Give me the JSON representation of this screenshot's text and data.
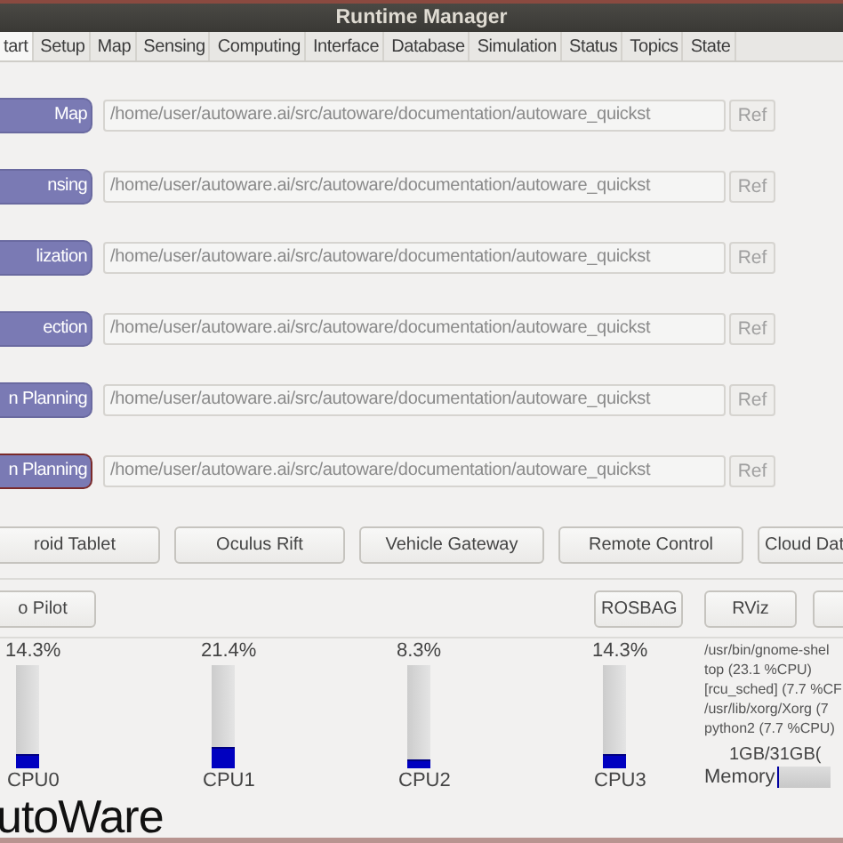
{
  "window": {
    "title": "Runtime Manager"
  },
  "tabs": [
    {
      "label": "tart",
      "selected": true
    },
    {
      "label": "Setup",
      "selected": false
    },
    {
      "label": "Map",
      "selected": false
    },
    {
      "label": "Sensing",
      "selected": false
    },
    {
      "label": "Computing",
      "selected": false
    },
    {
      "label": "Interface",
      "selected": false
    },
    {
      "label": "Database",
      "selected": false
    },
    {
      "label": "Simulation",
      "selected": false
    },
    {
      "label": "Status",
      "selected": false
    },
    {
      "label": "Topics",
      "selected": false
    },
    {
      "label": "State",
      "selected": false
    }
  ],
  "launch_rows": [
    {
      "button": "Map",
      "path": "/home/user/autoware.ai/src/autoware/documentation/autoware_quickst",
      "ref": "Ref",
      "focused": false
    },
    {
      "button": "nsing",
      "path": "/home/user/autoware.ai/src/autoware/documentation/autoware_quickst",
      "ref": "Ref",
      "focused": false
    },
    {
      "button": "lization",
      "path": "/home/user/autoware.ai/src/autoware/documentation/autoware_quickst",
      "ref": "Ref",
      "focused": false
    },
    {
      "button": "ection",
      "path": "/home/user/autoware.ai/src/autoware/documentation/autoware_quickst",
      "ref": "Ref",
      "focused": false
    },
    {
      "button": "n Planning",
      "path": "/home/user/autoware.ai/src/autoware/documentation/autoware_quickst",
      "ref": "Ref",
      "focused": false
    },
    {
      "button": "n Planning",
      "path": "/home/user/autoware.ai/src/autoware/documentation/autoware_quickst",
      "ref": "Ref",
      "focused": true
    }
  ],
  "tool_buttons": [
    "roid Tablet",
    "Oculus Rift",
    "Vehicle Gateway",
    "Remote Control",
    "Cloud Dat"
  ],
  "left_button": "o Pilot",
  "right_buttons": [
    "ROSBAG",
    "RViz"
  ],
  "cpus": [
    {
      "reading": "14.3%",
      "level": 0.143,
      "name": "CPU0"
    },
    {
      "reading": "21.4%",
      "level": 0.214,
      "name": "CPU1"
    },
    {
      "reading": "8.3%",
      "level": 0.083,
      "name": "CPU2"
    },
    {
      "reading": "14.3%",
      "level": 0.143,
      "name": "CPU3"
    }
  ],
  "processes": [
    "/usr/bin/gnome-shel",
    "top (23.1 %CPU)",
    "[rcu_sched] (7.7 %CF",
    "/usr/lib/xorg/Xorg (7",
    "python2 (7.7 %CPU)"
  ],
  "memory": {
    "reading": "1GB/31GB(",
    "label": "Memory",
    "level": 0.04
  },
  "logo": "utoWare"
}
